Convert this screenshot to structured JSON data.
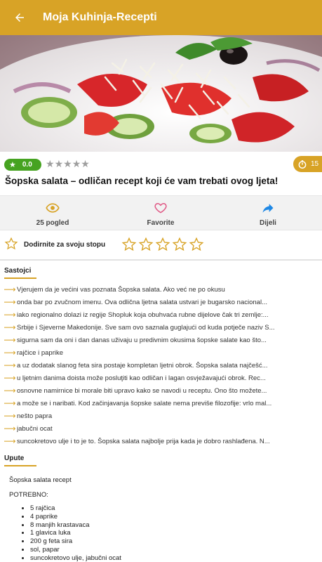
{
  "appbar": {
    "title": "Moja Kuhinja-Recepti",
    "back_icon": "arrow-left-icon"
  },
  "hero": {
    "alt": "Šopska salata photo"
  },
  "rating": {
    "score": "0.0",
    "stars_count": 5,
    "time": "15"
  },
  "recipe_title": "Šopska salata – odličan recept koji će vam trebati ovog ljeta!",
  "actions": {
    "views": "25 pogled",
    "favorite": "Favorite",
    "share": "Dijeli"
  },
  "rate_prompt": "Dodirnite za svoju stopu",
  "sections": {
    "ingredients_title": "Sastojci",
    "instructions_title": "Upute"
  },
  "ingredients": [
    "Vjerujem da je većini vas poznata Šopska salata. Ako već ne po okusu",
    "onda bar po zvučnom imenu. Ova odlična ljetna salata ustvari je bugarsko nacional...",
    "iako regionalno dolazi iz regije Shopluk koja obuhvaća rubne dijelove čak tri zemlje:...",
    "Srbije i Sjeverne Makedonije. Sve sam ovo saznala guglajući od kuda potječe naziv S...",
    "sigurna sam da oni i dan danas uživaju u predivnim okusima šopske salate kao što...",
    "rajčice i paprike",
    "a uz dodatak slanog feta sira postaje kompletan ljetni obrok. Šopska salata najčešć...",
    "u ljetnim danima doista može posluţiti kao odličan i lagan osvježavajući obrok.   Rec...",
    "osnovne namirnice bi morale biti upravo kako se navodi u receptu. Ono što možete...",
    "a može se i naribati. Kod začinjavanja šopske salate nema previše filozofije: vrlo mal...",
    "nešto papra",
    "jabučni ocat",
    "suncokretovo ulje i to je to. Šopska salata najbolje prija kada je dobro rashlađena. N..."
  ],
  "instructions": {
    "heading_line": "Šopska salata recept",
    "potrebno": "POTREBNO:",
    "items": [
      "5 rajčica",
      "4 paprike",
      "8 manjih krastavaca",
      "1 glavica luka",
      "200 g feta sira",
      "sol, papar",
      "suncokretovo ulje, jabučni ocat"
    ]
  },
  "colors": {
    "accent": "#d8a326",
    "score_green": "#46a321",
    "share_blue": "#1e88e5",
    "favorite_pink": "#e05a86"
  }
}
